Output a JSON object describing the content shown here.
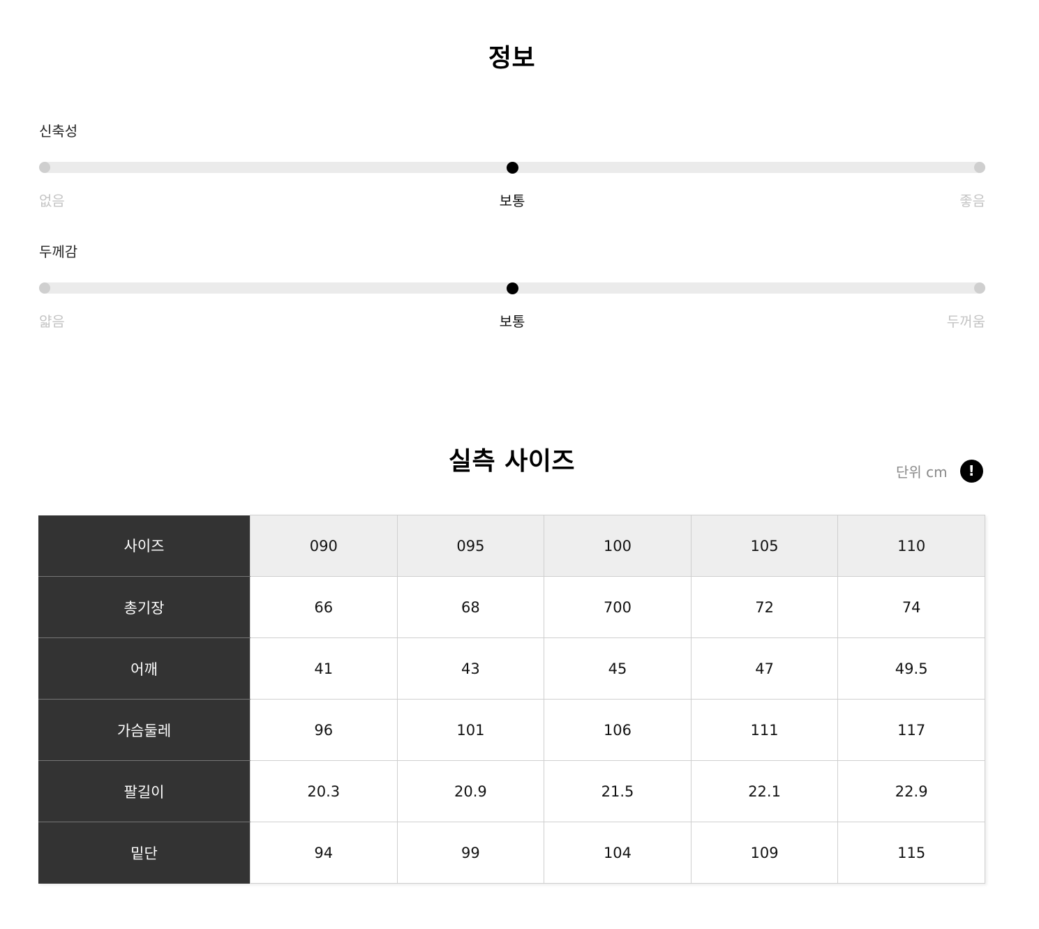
{
  "info": {
    "title": "정보",
    "attributes": [
      {
        "label": "신축성",
        "low": "없음",
        "mid": "보통",
        "high": "좋음",
        "level": 0.5
      },
      {
        "label": "두께감",
        "low": "얇음",
        "mid": "보통",
        "high": "두꺼움",
        "level": 0.5
      }
    ]
  },
  "size": {
    "title": "실측 사이즈",
    "unit": "단위 cm",
    "info_icon": "exclamation-icon",
    "header_label": "사이즈",
    "sizes": [
      "090",
      "095",
      "100",
      "105",
      "110"
    ],
    "rows": [
      {
        "label": "총기장",
        "values": [
          "66",
          "68",
          "700",
          "72",
          "74"
        ]
      },
      {
        "label": "어깨",
        "values": [
          "41",
          "43",
          "45",
          "47",
          "49.5"
        ]
      },
      {
        "label": "가슴둘레",
        "values": [
          "96",
          "101",
          "106",
          "111",
          "117"
        ]
      },
      {
        "label": "팔길이",
        "values": [
          "20.3",
          "20.9",
          "21.5",
          "22.1",
          "22.9"
        ]
      },
      {
        "label": "밑단",
        "values": [
          "94",
          "99",
          "104",
          "109",
          "115"
        ]
      }
    ]
  },
  "colors": {
    "row_header_bg": "#333333",
    "column_header_bg": "#eeeeee",
    "track": "#ebebeb",
    "knob": "#000000",
    "muted_text": "#c4c4c4"
  }
}
